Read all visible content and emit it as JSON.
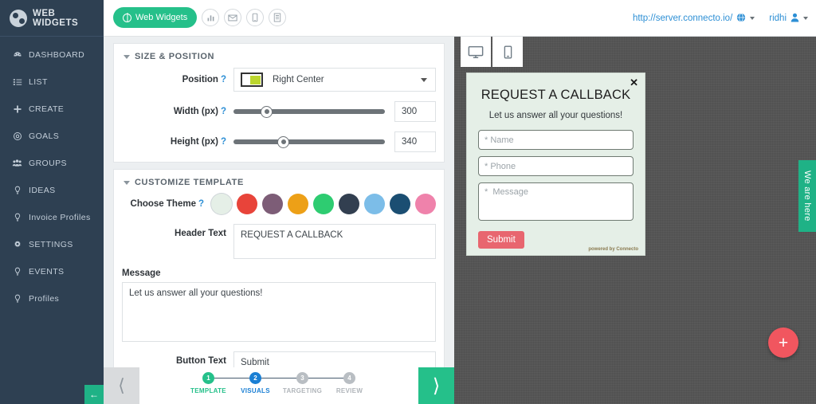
{
  "brand": {
    "name": "WEB WIDGETS",
    "logo_icon": "connecto-logo-icon"
  },
  "sidebar": {
    "items": [
      {
        "label": "DASHBOARD",
        "icon": "dashboard-icon"
      },
      {
        "label": "LIST",
        "icon": "list-icon"
      },
      {
        "label": "CREATE",
        "icon": "plus-icon"
      },
      {
        "label": "GOALS",
        "icon": "target-icon"
      },
      {
        "label": "GROUPS",
        "icon": "people-icon"
      },
      {
        "label": "IDEAS",
        "icon": "bulb-icon"
      },
      {
        "label": "Invoice Profiles",
        "icon": "bulb-icon"
      },
      {
        "label": "SETTINGS",
        "icon": "gear-icon"
      },
      {
        "label": "EVENTS",
        "icon": "bulb-icon"
      },
      {
        "label": "Profiles",
        "icon": "bulb-icon"
      }
    ],
    "collapse_icon": "arrow-left-icon"
  },
  "topbar": {
    "active_pill": {
      "label": "Web Widgets",
      "icon": "globe-icon",
      "color": "#25c08a"
    },
    "icon_buttons": [
      {
        "icon": "bar-chart-icon"
      },
      {
        "icon": "envelope-icon"
      },
      {
        "icon": "mobile-icon"
      },
      {
        "icon": "document-icon"
      }
    ],
    "site_url": "http://server.connecto.io/",
    "site_icon": "globe-icon",
    "user_name": "ridhi",
    "user_icon": "user-icon"
  },
  "editor": {
    "size_position": {
      "title": "SIZE & POSITION",
      "position": {
        "label": "Position",
        "help": "?",
        "value": "Right Center",
        "thumb_icon": "position-right-center-icon"
      },
      "width": {
        "label": "Width (px)",
        "help": "?",
        "value": "300",
        "slider_percent": 30
      },
      "height": {
        "label": "Height (px)",
        "help": "?",
        "value": "340",
        "slider_percent": 42
      }
    },
    "customize_template": {
      "title": "CUSTOMIZE TEMPLATE",
      "theme": {
        "label": "Choose Theme",
        "help": "?",
        "selected_index": 0,
        "colors": [
          "#e5efe7",
          "#e8443a",
          "#7d5d77",
          "#eda017",
          "#2ecc71",
          "#323f50",
          "#7cbde8",
          "#1b4e72",
          "#ef82ab"
        ]
      },
      "header_text": {
        "label": "Header Text",
        "value": "REQUEST A CALLBACK"
      },
      "message": {
        "label": "Message",
        "value": "Let us answer all your questions!"
      },
      "button_text": {
        "label": "Button Text",
        "value": "Submit"
      }
    }
  },
  "preview": {
    "devices": [
      {
        "name": "desktop",
        "icon": "desktop-icon",
        "active": true
      },
      {
        "name": "mobile",
        "icon": "mobile-icon",
        "active": false
      }
    ],
    "widget": {
      "close_label": "✕",
      "title": "REQUEST A CALLBACK",
      "subtitle": "Let us answer all your questions!",
      "fields": [
        {
          "name": "name",
          "placeholder": "* Name"
        },
        {
          "name": "phone",
          "placeholder": "* Phone"
        },
        {
          "name": "message",
          "placeholder": "*  Message"
        }
      ],
      "submit_label": "Submit",
      "powered_by": "powered by Connecto",
      "bg_color": "#e5efe7",
      "submit_color": "#e8666f"
    },
    "tab_label": "We are here",
    "tab_color": "#1fb286",
    "fab_label": "+",
    "fab_color": "#f1565f"
  },
  "wizard": {
    "prev_icon": "chevron-left-icon",
    "next_icon": "chevron-right-icon",
    "steps": [
      {
        "num": "1",
        "label": "TEMPLATE",
        "state": "done"
      },
      {
        "num": "2",
        "label": "VISUALS",
        "state": "cur"
      },
      {
        "num": "3",
        "label": "TARGETING",
        "state": "todo"
      },
      {
        "num": "4",
        "label": "REVIEW",
        "state": "todo"
      }
    ]
  }
}
